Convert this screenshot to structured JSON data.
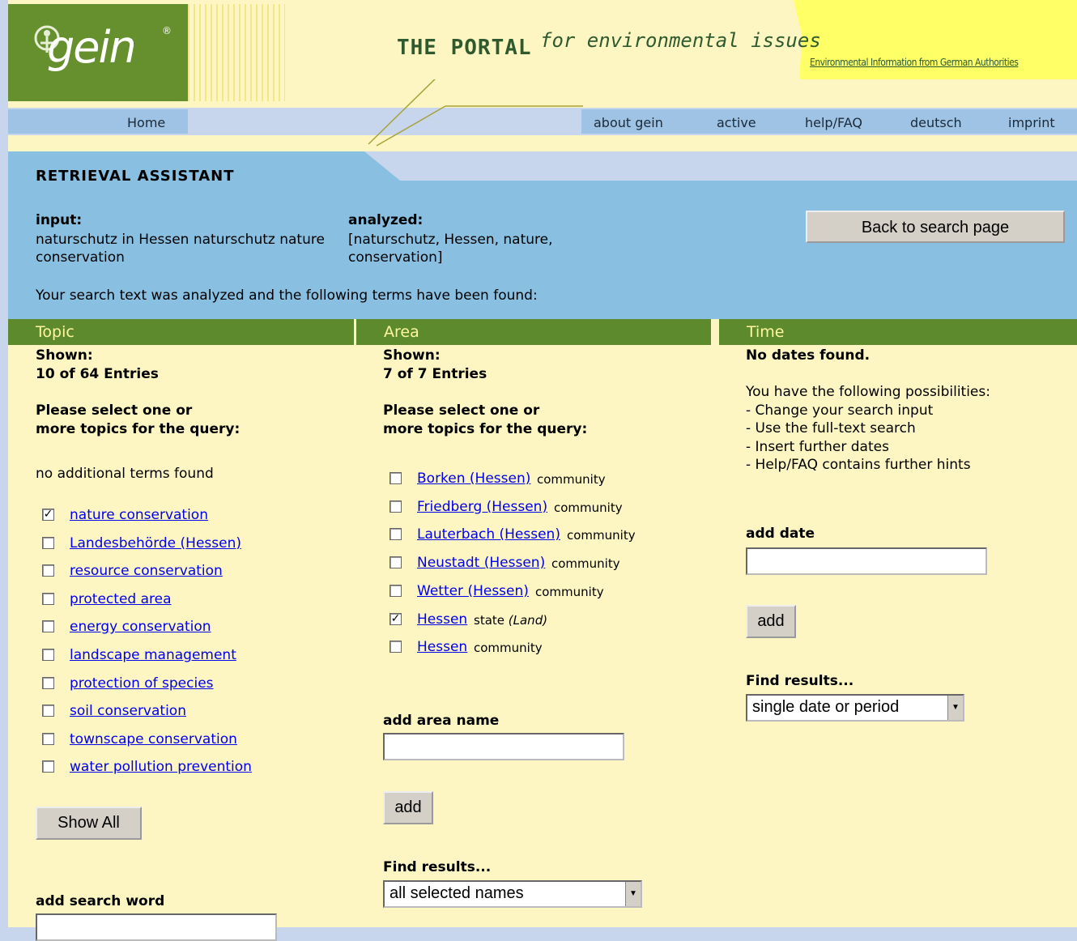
{
  "header": {
    "logo": "gein",
    "portal_title": "THE PORTAL",
    "portal_sub": "for environmental issues",
    "tagline": "Environmental Information from German Authorities"
  },
  "nav": {
    "home": "Home",
    "items": [
      "about gein",
      "active",
      "help/FAQ",
      "deutsch",
      "imprint"
    ]
  },
  "retrieval": {
    "title": "RETRIEVAL ASSISTANT",
    "input_label": "input:",
    "input_value": "naturschutz in Hessen naturschutz nature conservation",
    "analyzed_label": "analyzed:",
    "analyzed_value": "[naturschutz, Hessen, nature, conservation]",
    "back_button": "Back to search page",
    "found_text": "Your search text was analyzed and the following terms have been found:"
  },
  "topic": {
    "heading": "Topic",
    "shown_label": "Shown:",
    "shown_value": "10 of 64 Entries",
    "select_prompt_1": "Please select one or",
    "select_prompt_2": "more topics for the query:",
    "no_terms": "no additional terms found",
    "items": [
      {
        "label": "nature conservation",
        "checked": true
      },
      {
        "label": "Landesbehörde (Hessen)",
        "checked": false
      },
      {
        "label": "resource conservation",
        "checked": false
      },
      {
        "label": "protected area",
        "checked": false
      },
      {
        "label": "energy conservation",
        "checked": false
      },
      {
        "label": "landscape management",
        "checked": false
      },
      {
        "label": "protection of species",
        "checked": false
      },
      {
        "label": "soil conservation",
        "checked": false
      },
      {
        "label": "townscape conservation",
        "checked": false
      },
      {
        "label": "water pollution prevention",
        "checked": false
      }
    ],
    "show_all": "Show All",
    "add_word_label": "add search word"
  },
  "area": {
    "heading": "Area",
    "shown_label": "Shown:",
    "shown_value": "7 of 7 Entries",
    "select_prompt_1": "Please select one or",
    "select_prompt_2": "more topics for the query:",
    "items": [
      {
        "label": "Borken (Hessen)",
        "suffix": "community",
        "checked": false
      },
      {
        "label": "Friedberg (Hessen)",
        "suffix": "community",
        "checked": false
      },
      {
        "label": "Lauterbach (Hessen)",
        "suffix": "community",
        "checked": false
      },
      {
        "label": "Neustadt (Hessen)",
        "suffix": "community",
        "checked": false
      },
      {
        "label": "Wetter (Hessen)",
        "suffix": "community",
        "checked": false
      },
      {
        "label": "Hessen",
        "suffix": "state",
        "suffix_italic": "(Land)",
        "checked": true
      },
      {
        "label": "Hessen",
        "suffix": "community",
        "checked": false
      }
    ],
    "add_label": "add area name",
    "add_button": "add",
    "find_label": "Find results...",
    "find_value": "all selected names"
  },
  "time": {
    "heading": "Time",
    "no_dates": "No dates found.",
    "possibilities": [
      "You have the following possibilities:",
      "- Change your search input",
      "- Use the full-text search",
      "- Insert further dates",
      "- Help/FAQ contains further hints"
    ],
    "add_label": "add date",
    "add_button": "add",
    "find_label": "Find results...",
    "find_value": "single date or period"
  }
}
